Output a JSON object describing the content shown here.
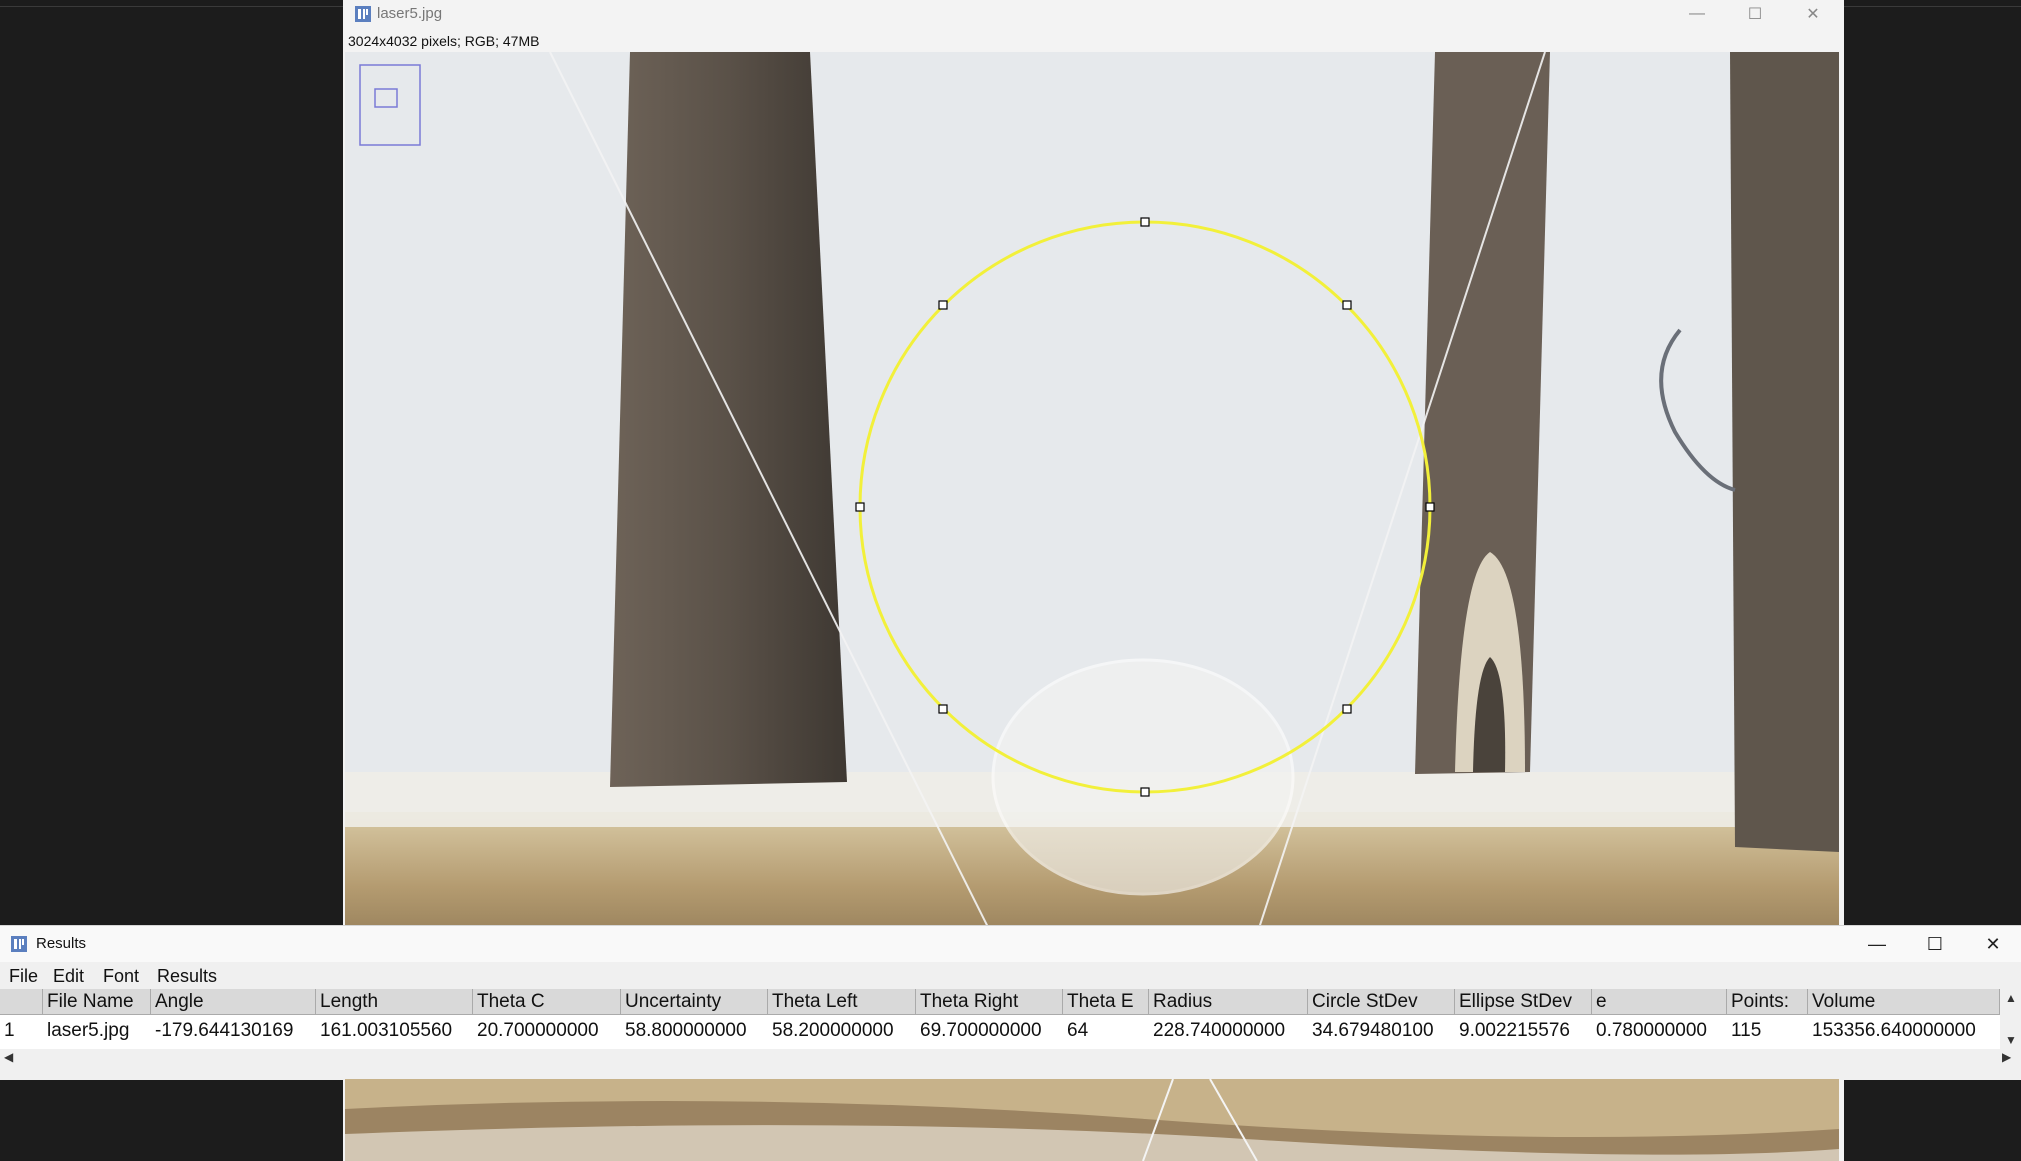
{
  "image_window": {
    "title": "laser5.jpg",
    "info": "3024x4032 pixels; RGB; 47MB",
    "controls": {
      "minimize": "—",
      "maximize": "☐",
      "close": "✕"
    }
  },
  "results_window": {
    "title": "Results",
    "controls": {
      "minimize": "—",
      "maximize": "☐",
      "close": "✕"
    },
    "menu": [
      "File",
      "Edit",
      "Font",
      "Results"
    ],
    "columns": [
      "",
      "File Name",
      "Angle",
      "Length",
      "Theta C",
      "Uncertainty",
      "Theta Left",
      "Theta Right",
      "Theta E",
      "Radius",
      "Circle StDev",
      "Ellipse StDev",
      "e",
      "Points:",
      "Volume"
    ],
    "rows": [
      [
        "1",
        "laser5.jpg",
        "-179.644130169",
        "161.003105560",
        "20.700000000",
        "58.800000000",
        "58.200000000",
        "69.700000000",
        "64",
        "228.740000000",
        "34.679480100",
        "9.002215576",
        "0.780000000",
        "115",
        "153356.640000000"
      ]
    ]
  },
  "colors": {
    "circle_selection": "#f2f03a",
    "background": "#1c1c1c",
    "header": "#d9d9d9"
  }
}
